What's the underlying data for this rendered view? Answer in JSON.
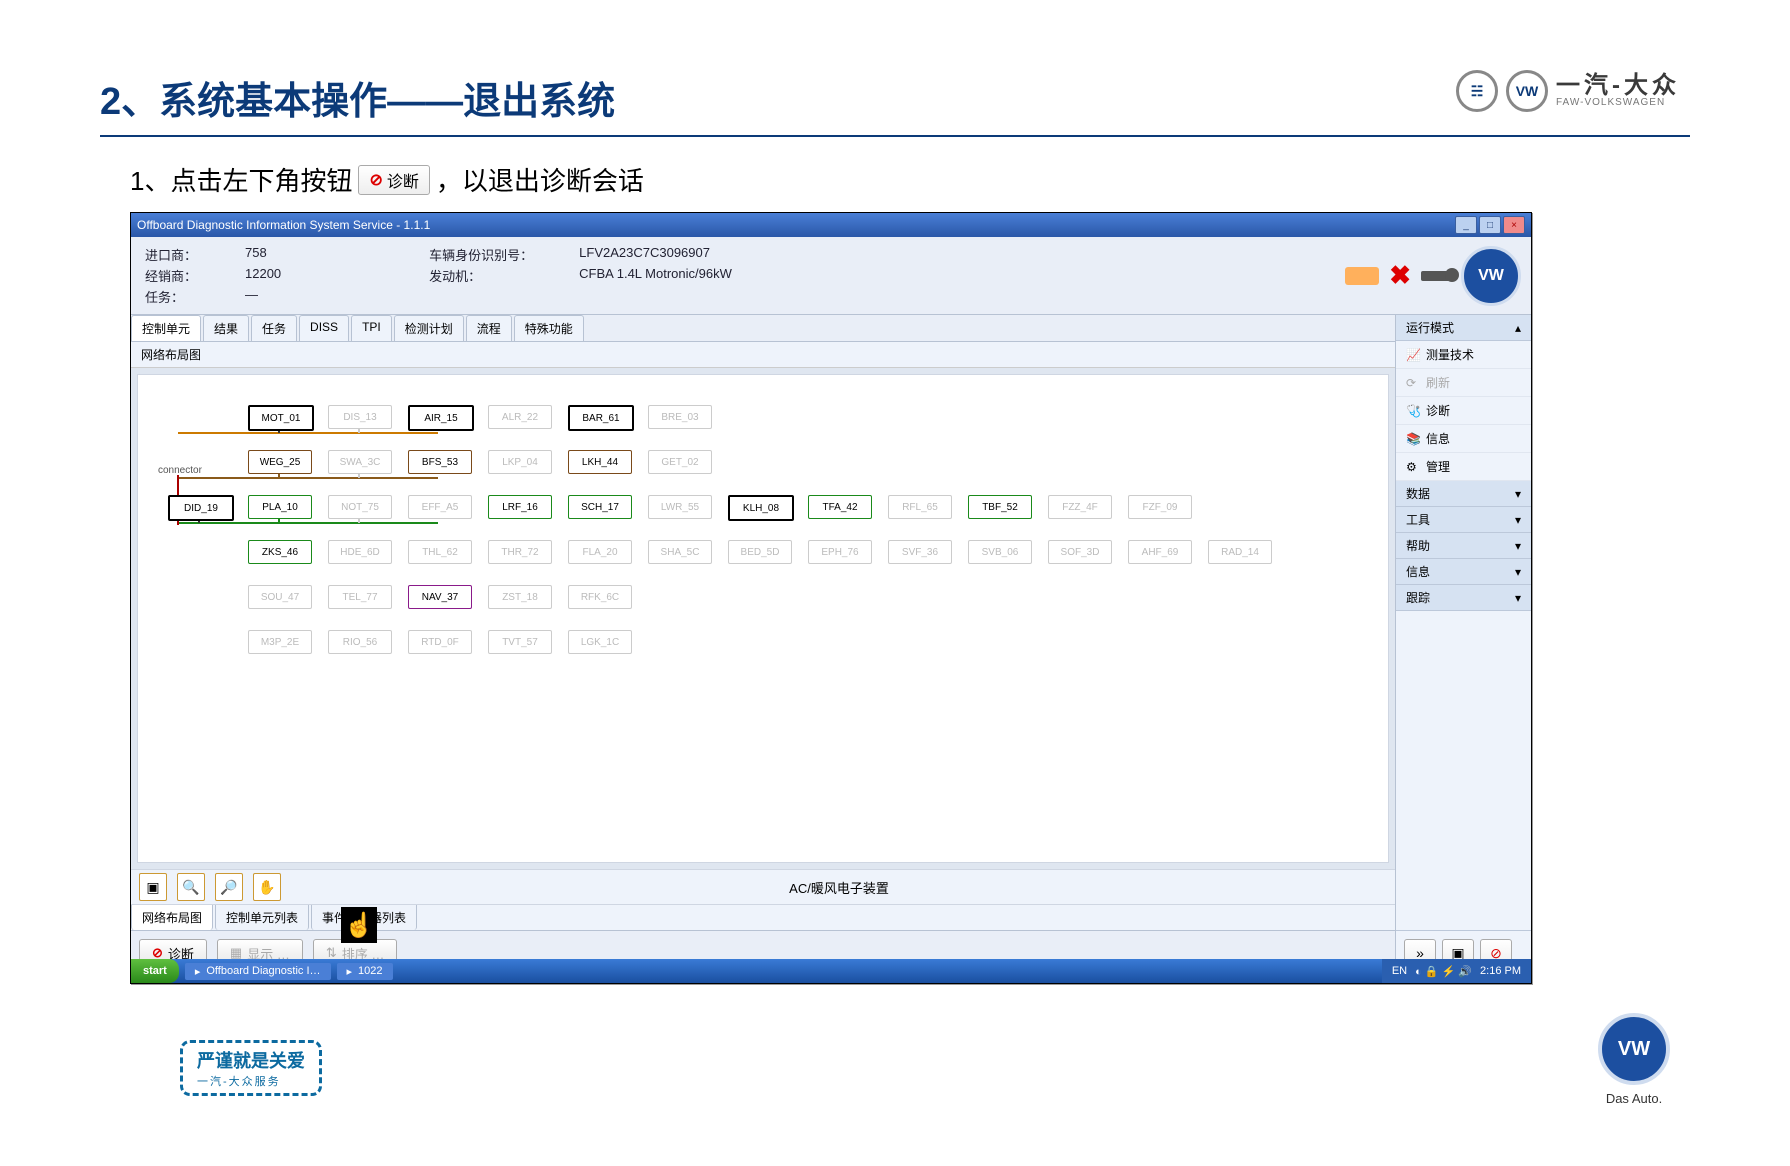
{
  "slide": {
    "title": "2、系统基本操作——退出系统",
    "brand_cn": "一汽-大众",
    "brand_en": "FAW-VOLKSWAGEN",
    "instruction_pre": "1、点击左下角按钮",
    "instruction_btn": "诊断",
    "instruction_post": "，以退出诊断会话",
    "bottom_slogan": "严谨就是关爱",
    "bottom_slogan_sub": "一汽-大众服务",
    "das_auto": "Das Auto."
  },
  "window": {
    "title": "Offboard Diagnostic Information System Service - 1.1.1",
    "header": {
      "importer_label": "进口商：",
      "importer_value": "758",
      "dealer_label": "经销商：",
      "dealer_value": "12200",
      "task_label": "任务：",
      "task_value": "—",
      "vin_label": "车辆身份识别号：",
      "vin_value": "LFV2A23C7C3096907",
      "engine_label": "发动机：",
      "engine_value": "CFBA 1.4L Motronic/96kW"
    },
    "tabs": [
      "控制单元",
      "结果",
      "任务",
      "DISS",
      "TPI",
      "检测计划",
      "流程",
      "特殊功能"
    ],
    "panel_title": "网络布局图",
    "connector_label": "connector",
    "diagram_rows": [
      [
        {
          "t": "MOT_01",
          "c": "hl"
        },
        {
          "t": "DIS_13",
          "c": "dim"
        },
        {
          "t": "AIR_15",
          "c": "hl"
        },
        {
          "t": "ALR_22",
          "c": "dim"
        },
        {
          "t": "BAR_61",
          "c": "hl"
        },
        {
          "t": "BRE_03",
          "c": "dim"
        }
      ],
      [
        {
          "t": "WEG_25",
          "c": "brown"
        },
        {
          "t": "SWA_3C",
          "c": "dim"
        },
        {
          "t": "BFS_53",
          "c": "brown"
        },
        {
          "t": "LKP_04",
          "c": "dim"
        },
        {
          "t": "LKH_44",
          "c": "brown"
        },
        {
          "t": "GET_02",
          "c": "dim"
        }
      ],
      [
        {
          "t": "DID_19",
          "c": "hl",
          "x": -1
        },
        {
          "t": "PLA_10",
          "c": "green"
        },
        {
          "t": "NOT_75",
          "c": "dim"
        },
        {
          "t": "EFF_A5",
          "c": "dim"
        },
        {
          "t": "LRF_16",
          "c": "green"
        },
        {
          "t": "SCH_17",
          "c": "green"
        },
        {
          "t": "LWR_55",
          "c": "dim"
        },
        {
          "t": "KLH_08",
          "c": "hl"
        },
        {
          "t": "TFA_42",
          "c": "green"
        },
        {
          "t": "RFL_65",
          "c": "dim"
        },
        {
          "t": "TBF_52",
          "c": "green"
        },
        {
          "t": "FZZ_4F",
          "c": "dim"
        },
        {
          "t": "FZF_09",
          "c": "dim"
        }
      ],
      [
        {
          "t": "ZKS_46",
          "c": "green"
        },
        {
          "t": "HDE_6D",
          "c": "dim"
        },
        {
          "t": "THL_62",
          "c": "dim"
        },
        {
          "t": "THR_72",
          "c": "dim"
        },
        {
          "t": "FLA_20",
          "c": "dim"
        },
        {
          "t": "SHA_5C",
          "c": "dim"
        },
        {
          "t": "BED_5D",
          "c": "dim"
        },
        {
          "t": "EPH_76",
          "c": "dim"
        },
        {
          "t": "SVF_36",
          "c": "dim"
        },
        {
          "t": "SVB_06",
          "c": "dim"
        },
        {
          "t": "SOF_3D",
          "c": "dim"
        },
        {
          "t": "AHF_69",
          "c": "dim"
        },
        {
          "t": "RAD_14",
          "c": "dim"
        }
      ],
      [
        {
          "t": "SOU_47",
          "c": "dim"
        },
        {
          "t": "TEL_77",
          "c": "dim"
        },
        {
          "t": "NAV_37",
          "c": "purple"
        },
        {
          "t": "ZST_18",
          "c": "dim"
        },
        {
          "t": "RFK_6C",
          "c": "dim"
        }
      ],
      [
        {
          "t": "M3P_2E",
          "c": "dim"
        },
        {
          "t": "RIO_56",
          "c": "dim"
        },
        {
          "t": "RTD_0F",
          "c": "dim"
        },
        {
          "t": "TVT_57",
          "c": "dim"
        },
        {
          "t": "LGK_1C",
          "c": "dim"
        }
      ]
    ],
    "toolbar_center": "AC/暖风电子装置",
    "subtabs": [
      "网络布局图",
      "控制单元列表",
      "事件存储器列表"
    ],
    "footer": {
      "diag": "诊断",
      "show": "显示 …",
      "sort": "排序 …"
    },
    "sidebar": {
      "mode_hdr": "运行模式",
      "items_mode": [
        {
          "t": "测量技术",
          "ico": "📈"
        },
        {
          "t": "刷新",
          "ico": "⟳",
          "dim": true
        },
        {
          "t": "诊断",
          "ico": "🩺"
        },
        {
          "t": "信息",
          "ico": "📚"
        },
        {
          "t": "管理",
          "ico": "⚙"
        }
      ],
      "sections": [
        "数据",
        "工具",
        "帮助",
        "信息",
        "跟踪"
      ]
    }
  },
  "taskbar": {
    "start": "start",
    "tasks": [
      "Offboard Diagnostic I…",
      "1022"
    ],
    "lang": "EN",
    "time": "2:16 PM"
  }
}
